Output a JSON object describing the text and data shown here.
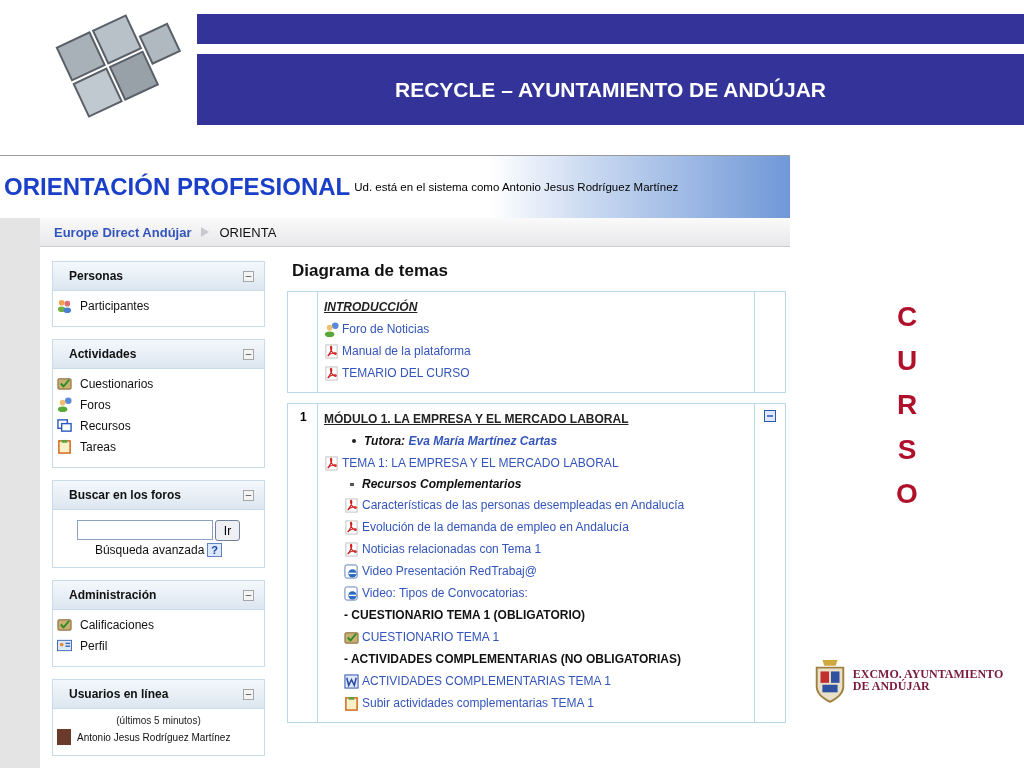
{
  "slide": {
    "title": "RECYCLE – AYUNTAMIENTO DE ANDÚJAR",
    "side_text": "CURSO",
    "crest_lines": [
      "EXCMO. AYUNTAMIENTO",
      "DE ANDÚJAR"
    ]
  },
  "site": {
    "title": "ORIENTACIÓN PROFESIONAL",
    "login_text": "Ud. está en el sistema como Antonio Jesus Rodríguez Martínez",
    "breadcrumb": [
      {
        "label": "Europe Direct Andújar",
        "kind": "link"
      },
      {
        "label": "ORIENTA",
        "kind": "current"
      }
    ]
  },
  "sidebar": [
    {
      "title": "Personas",
      "kind": "links",
      "items": [
        {
          "label": "Participantes",
          "kind": "people"
        }
      ]
    },
    {
      "title": "Actividades",
      "kind": "links",
      "items": [
        {
          "label": "Cuestionarios",
          "kind": "quiz"
        },
        {
          "label": "Foros",
          "kind": "forum"
        },
        {
          "label": "Recursos",
          "kind": "resource"
        },
        {
          "label": "Tareas",
          "kind": "assignment"
        }
      ]
    },
    {
      "title": "Buscar en los foros",
      "kind": "search",
      "button": "Ir",
      "link": "Búsqueda avanzada",
      "help": "?"
    },
    {
      "title": "Administración",
      "kind": "links",
      "items": [
        {
          "label": "Calificaciones",
          "kind": "quiz"
        },
        {
          "label": "Perfil",
          "kind": "profile"
        }
      ]
    },
    {
      "title": "Usuarios en línea",
      "kind": "online",
      "note": "(últimos 5 minutos)",
      "users": [
        {
          "name": "Antonio Jesus Rodríguez Martínez"
        }
      ]
    }
  ],
  "main": {
    "title": "Diagrama de temas",
    "sections": [
      {
        "collapsible": false,
        "items": [
          {
            "kind": "title",
            "italic": true,
            "text": "INTRODUCCIÓN"
          },
          {
            "kind": "forum",
            "text": "Foro de Noticias"
          },
          {
            "kind": "pdf",
            "text": "Manual de la plataforma"
          },
          {
            "kind": "pdf",
            "text": "TEMARIO DEL CURSO"
          }
        ]
      },
      {
        "number": "1",
        "collapsible": true,
        "items": [
          {
            "kind": "title",
            "italic": false,
            "text": "MÓDULO 1. LA EMPRESA Y EL MERCADO LABORAL"
          },
          {
            "kind": "bullet",
            "label": "Tutora:",
            "text": "Eva María Martínez Cartas"
          },
          {
            "kind": "pdf",
            "text": "TEMA 1: LA EMPRESA Y EL MERCADO LABORAL",
            "children": [
              {
                "kind": "subbullet",
                "text": "Recursos Complementarios"
              },
              {
                "kind": "pdf",
                "text": "Características de las personas desempleadas en Andalucía"
              },
              {
                "kind": "pdf",
                "text": "Evolución de la demanda de empleo en Andalucía"
              },
              {
                "kind": "pdf",
                "text": "Noticias relacionadas con Tema 1"
              },
              {
                "kind": "video",
                "text": "Video Presentación RedTrabaj@"
              },
              {
                "kind": "video",
                "text": "Video: Tipos de Convocatorias:"
              },
              {
                "kind": "heading",
                "text": "- CUESTIONARIO TEMA 1 (OBLIGATORIO)"
              },
              {
                "kind": "quiz",
                "text": "CUESTIONARIO TEMA 1"
              },
              {
                "kind": "heading",
                "text": "- ACTIVIDADES COMPLEMENTARIAS (NO OBLIGATORIAS)"
              },
              {
                "kind": "word",
                "text": "ACTIVIDADES COMPLEMENTARIAS TEMA 1"
              },
              {
                "kind": "assignment",
                "text": "Subir actividades complementarias TEMA 1"
              }
            ]
          }
        ]
      }
    ]
  }
}
